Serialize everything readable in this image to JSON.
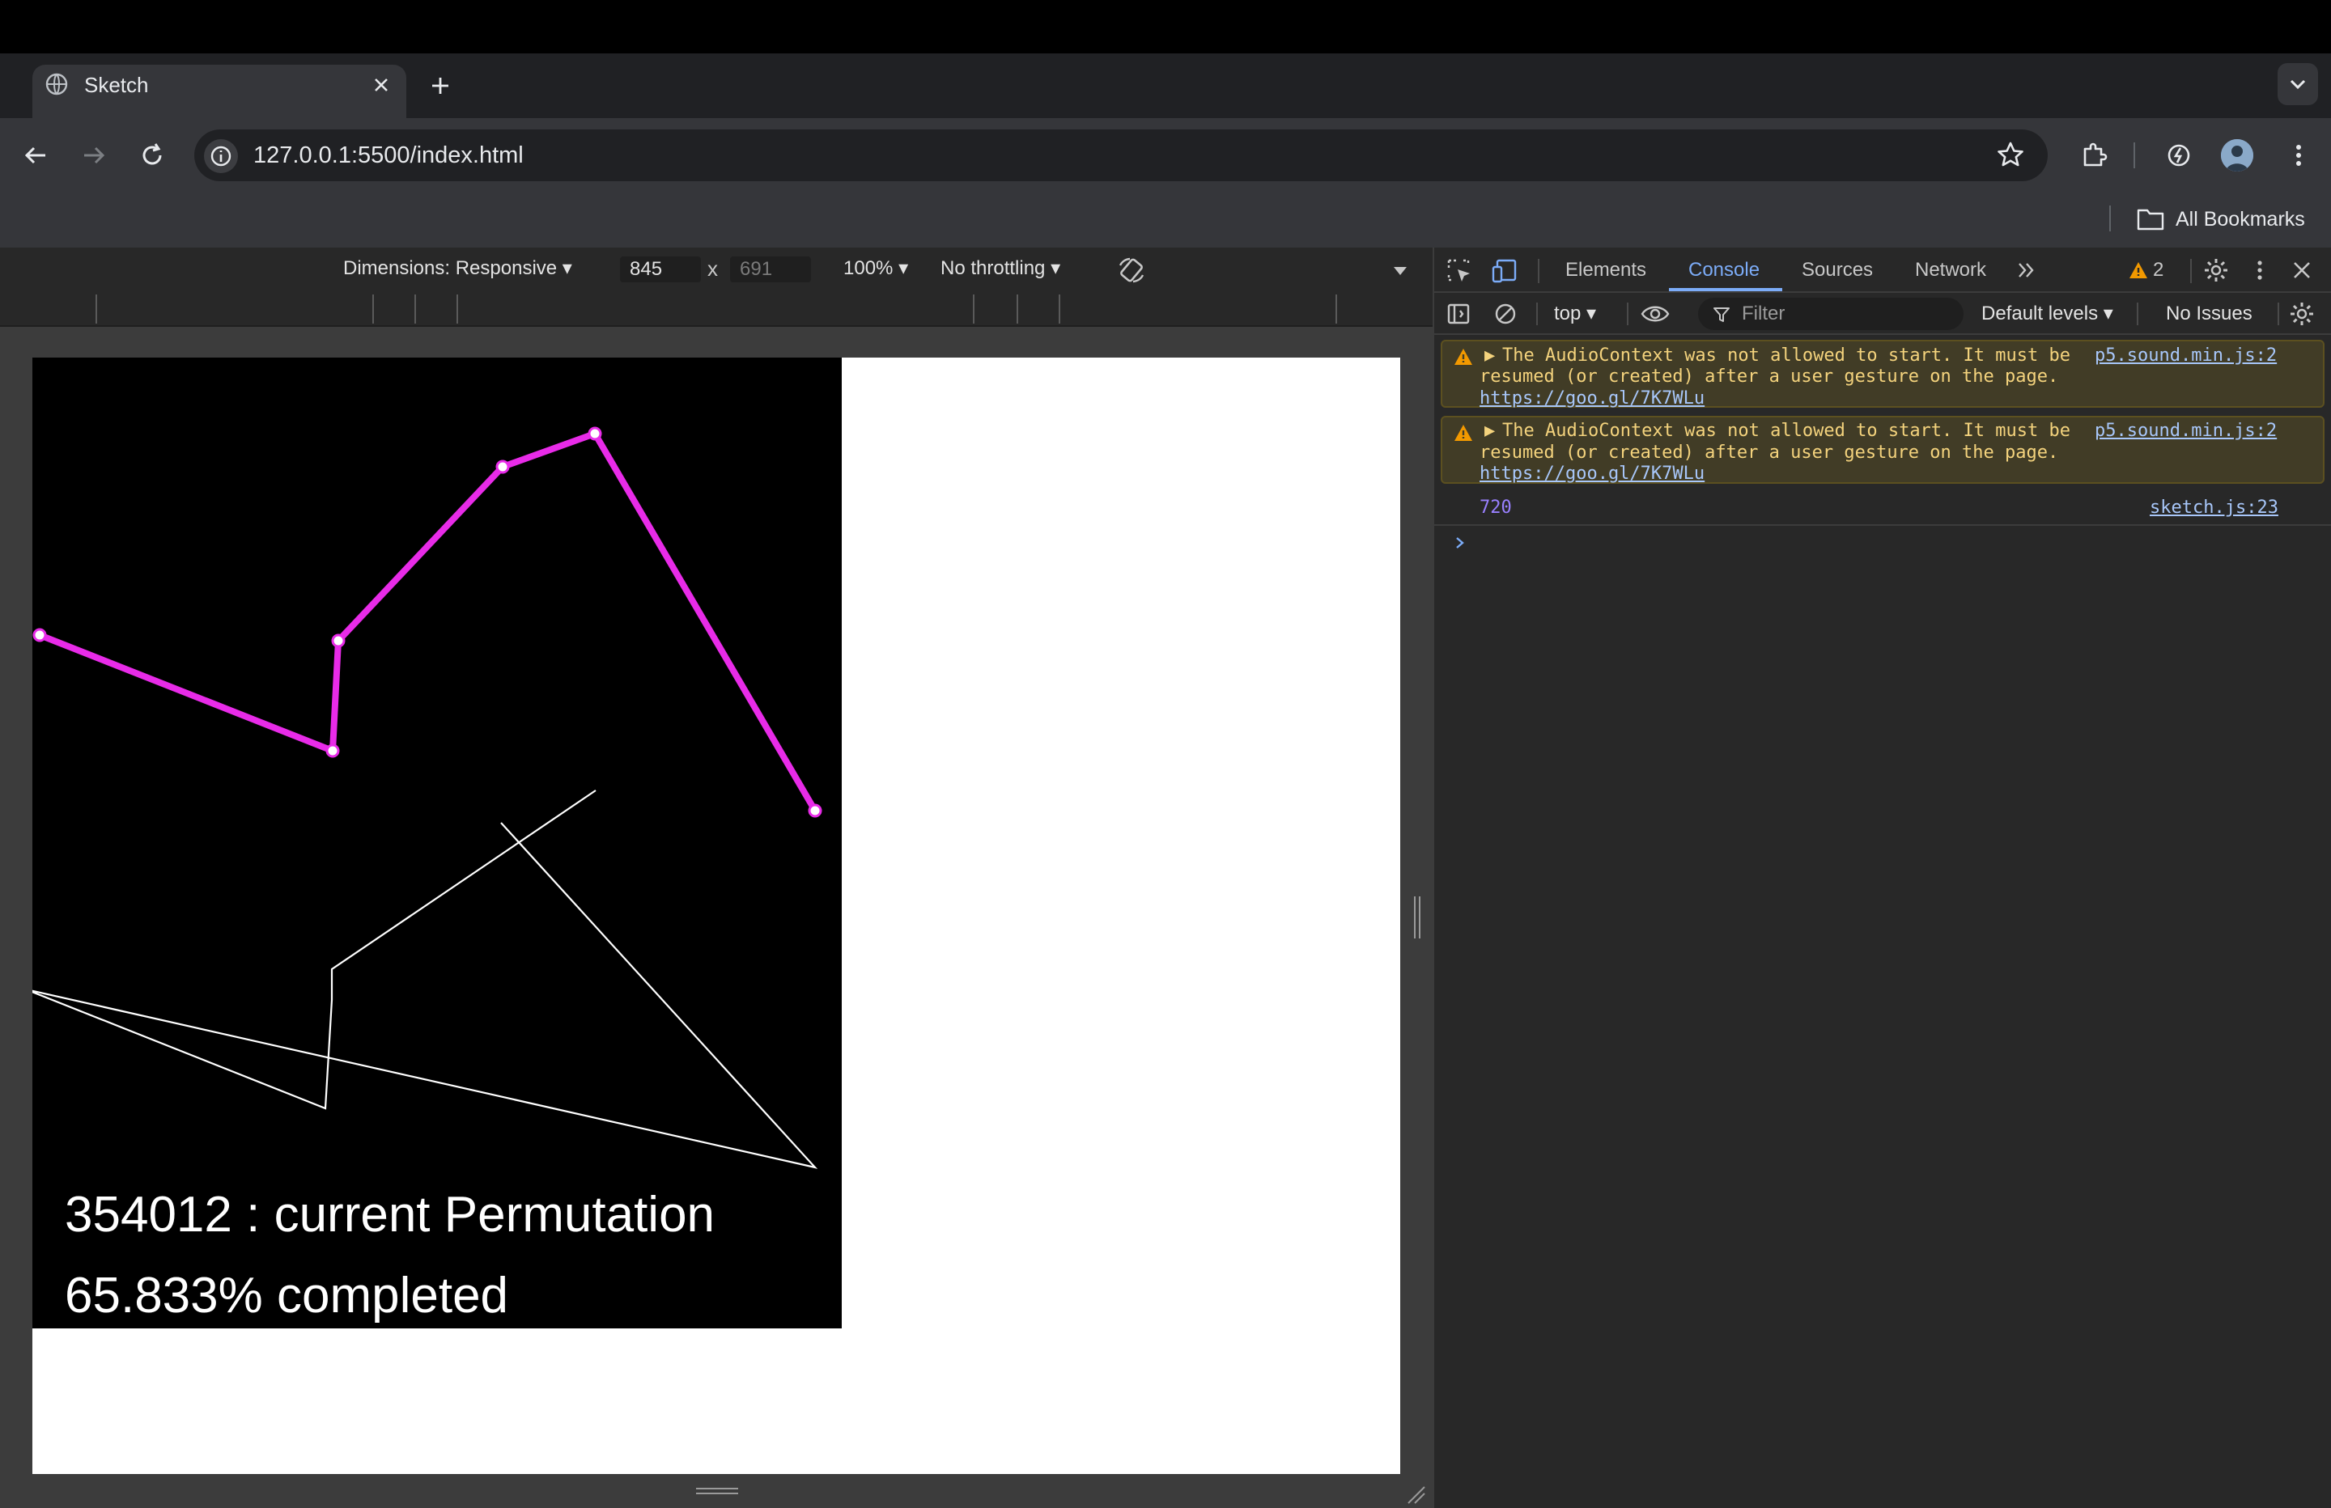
{
  "browser": {
    "tab_title": "Sketch",
    "url": "127.0.0.1:5500/index.html",
    "bookmarks_label": "All Bookmarks"
  },
  "device_toolbar": {
    "dimensions_label": "Dimensions: Responsive",
    "width": "845",
    "height_placeholder": "691",
    "times": "x",
    "zoom": "100%",
    "throttling": "No throttling"
  },
  "sketch": {
    "permutation_text": "354012 : current Permutation",
    "completed_text": "65.833% completed",
    "colors": {
      "best_path": "#e82be8",
      "current_path": "#ffffff",
      "background": "#000000"
    }
  },
  "devtools": {
    "tabs": [
      "Elements",
      "Console",
      "Sources",
      "Network"
    ],
    "active_tab": "Console",
    "warning_count": "2",
    "context": "top",
    "filter_placeholder": "Filter",
    "levels": "Default levels",
    "issues": "No Issues"
  },
  "console": {
    "messages": [
      {
        "line1": "The AudioContext was not allowed to start. It must be",
        "line2": "resumed (or created) after a user gesture on the page.",
        "link": "https://goo.gl/7K7WLu",
        "source": "p5.sound.min.js:2"
      },
      {
        "line1": "The AudioContext was not allowed to start. It must be",
        "line2": "resumed (or created) after a user gesture on the page.",
        "link": "https://goo.gl/7K7WLu",
        "source": "p5.sound.min.js:2"
      }
    ],
    "log_value": "720",
    "log_source": "sketch.js:23"
  }
}
